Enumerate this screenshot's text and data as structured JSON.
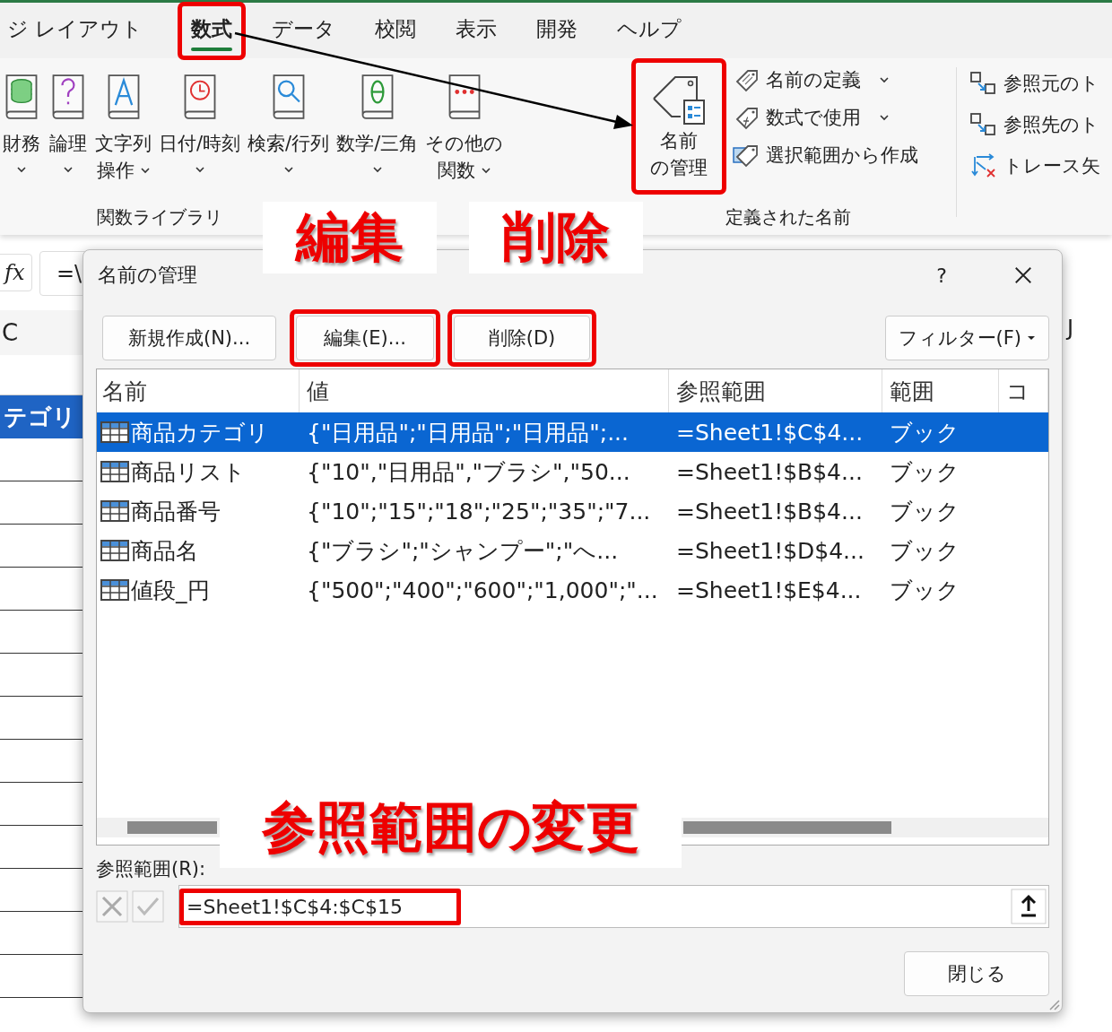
{
  "ribbon": {
    "tabs": [
      {
        "label": "ジ レイアウト",
        "selected": false,
        "highlighted": false
      },
      {
        "label": "数式",
        "selected": true,
        "highlighted": true
      },
      {
        "label": "データ",
        "selected": false,
        "highlighted": false
      },
      {
        "label": "校閲",
        "selected": false,
        "highlighted": false
      },
      {
        "label": "表示",
        "selected": false,
        "highlighted": false
      },
      {
        "label": "開発",
        "selected": false,
        "highlighted": false
      },
      {
        "label": "ヘルプ",
        "selected": false,
        "highlighted": false
      }
    ],
    "function_library": {
      "buttons": [
        {
          "label": [
            "財務"
          ]
        },
        {
          "label": [
            "論理"
          ]
        },
        {
          "label": [
            "文字列",
            "操作"
          ]
        },
        {
          "label": [
            "日付/時刻"
          ]
        },
        {
          "label": [
            "検索/行列"
          ]
        },
        {
          "label": [
            "数学/三角"
          ]
        },
        {
          "label": [
            "その他の",
            "関数"
          ]
        }
      ],
      "group_label": "関数ライブラリ"
    },
    "defined_names": {
      "manager_button": {
        "label": [
          "名前",
          "の管理"
        ],
        "highlighted": true
      },
      "commands": [
        {
          "label": "名前の定義",
          "dropdown": true
        },
        {
          "label": "数式で使用",
          "dropdown": true
        },
        {
          "label": "選択範囲から作成",
          "dropdown": false
        }
      ],
      "group_label": "定義された名前"
    },
    "formula_auditing": {
      "commands": [
        {
          "label": "参照元のト"
        },
        {
          "label": "参照先のト"
        },
        {
          "label": "トレース矢"
        }
      ]
    }
  },
  "sheet": {
    "function_label": "fx",
    "formula_bar": "=\\",
    "column_headers": [
      "C",
      "J"
    ],
    "selected_cell": "テゴリ"
  },
  "dialog": {
    "title": "名前の管理",
    "help": "?",
    "buttons": [
      {
        "label": "新規作成(N)...",
        "highlighted": false
      },
      {
        "label": "編集(E)...",
        "highlighted": true
      },
      {
        "label": "削除(D)",
        "highlighted": true
      }
    ],
    "filter_button": "フィルター(F)",
    "columns": [
      "名前",
      "値",
      "参照範囲",
      "範囲",
      "コ"
    ],
    "rows": [
      {
        "name": "商品カテゴリ",
        "value": "{\"日用品\";\"日用品\";\"日用品\";...",
        "refers_to": "=Sheet1!$C$4...",
        "scope": "ブック",
        "selected": true
      },
      {
        "name": "商品リスト",
        "value": "{\"10\",\"日用品\",\"ブラシ\",\"50...",
        "refers_to": "=Sheet1!$B$4...",
        "scope": "ブック",
        "selected": false
      },
      {
        "name": "商品番号",
        "value": "{\"10\";\"15\";\"18\";\"25\";\"35\";\"7...",
        "refers_to": "=Sheet1!$B$4...",
        "scope": "ブック",
        "selected": false
      },
      {
        "name": "商品名",
        "value": "{\"ブラシ\";\"シャンプー\";\"へ...",
        "refers_to": "=Sheet1!$D$4...",
        "scope": "ブック",
        "selected": false
      },
      {
        "name": "値段_円",
        "value": "{\"500\";\"400\";\"600\";\"1,000\";\"...",
        "refers_to": "=Sheet1!$E$4...",
        "scope": "ブック",
        "selected": false
      }
    ],
    "refers_to_label": "参照範囲(R):",
    "refers_to_field": {
      "value": "=Sheet1!$C$4:$C$15",
      "highlighted": true
    },
    "close_button": "閉じる"
  },
  "annotations": [
    {
      "text": "編集"
    },
    {
      "text": "削除"
    },
    {
      "text": "参照範囲の変更"
    }
  ]
}
